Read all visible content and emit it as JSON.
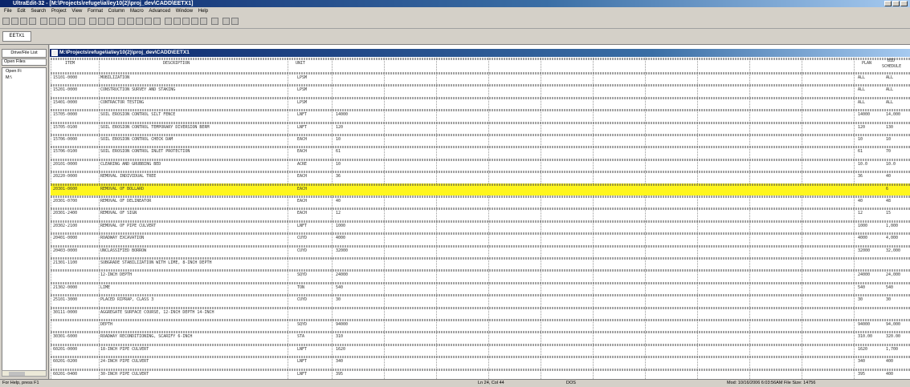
{
  "title": "UltraEdit-32 - [M:\\Projects\\refuge\\ia\\ley10(2)\\proj_dev\\CADD\\EETX1]",
  "menu": [
    "File",
    "Edit",
    "Search",
    "Project",
    "View",
    "Format",
    "Column",
    "Macro",
    "Advanced",
    "Window",
    "Help"
  ],
  "file_tab": "EETX1",
  "drive_tab": "Drive/File List",
  "open_files": "Open Files",
  "tree": [
    "Open Fi",
    "M:\\"
  ],
  "doc_title": "M:\\Projects\\refuge\\ia\\ley10(2)\\proj_dev\\CADD\\EETX1",
  "headers": {
    "item": "ITEM",
    "description": "DESCRIPTION",
    "unit": "UNIT",
    "plan": "PLAN",
    "bid": "BID",
    "schedule": "SCHEDULE"
  },
  "rows": [
    {
      "item": "15101-0000",
      "desc": "MOBILIZATION",
      "unit": "LPSM",
      "qty": "",
      "plan": "ALL",
      "bid": "ALL"
    },
    {
      "item": "15201-0000",
      "desc": "CONSTRUCTION SURVEY AND STAKING",
      "unit": "LPSM",
      "qty": "",
      "plan": "ALL",
      "bid": "ALL"
    },
    {
      "item": "15401-0000",
      "desc": "CONTRACTOR TESTING",
      "unit": "LPSM",
      "qty": "",
      "plan": "ALL",
      "bid": "ALL"
    },
    {
      "item": "15705-0000",
      "desc": "SOIL EROSION CONTROL  SILT FENCE",
      "unit": "LNFT",
      "qty": "14000",
      "plan": "14000",
      "bid": "14,000"
    },
    {
      "item": "15705-0100",
      "desc": "SOIL EROSION CONTROL  TEMPORARY DIVERSION BERM",
      "unit": "LNFT",
      "qty": "120",
      "plan": "120",
      "bid": "130"
    },
    {
      "item": "15706-0000",
      "desc": "SOIL EROSION CONTROL  CHECK DAM",
      "unit": "EACH",
      "qty": "10",
      "plan": "10",
      "bid": "10"
    },
    {
      "item": "15706-0100",
      "desc": "SOIL EROSION CONTROL  INLET PROTECTION",
      "unit": "EACH",
      "qty": "61",
      "plan": "61",
      "bid": "70"
    },
    {
      "item": "20101-0000",
      "desc": "CLEARING AND GRUBBING BED",
      "unit": "ACRE",
      "qty": "10",
      "plan": "10.0",
      "bid": "10.0"
    },
    {
      "item": "20220-0000",
      "desc": "REMOVAL  INDIVIDUAL TREE",
      "unit": "EACH",
      "qty": "36",
      "plan": "36",
      "bid": "40"
    },
    {
      "item": "20301-0600",
      "desc": "REMOVAL OF BOLLARD",
      "unit": "EACH",
      "qty": "",
      "plan": "",
      "bid": "6",
      "highlight": true
    },
    {
      "item": "20301-0700",
      "desc": "REMOVAL OF DELINEATOR",
      "unit": "EACH",
      "qty": "40",
      "plan": "40",
      "bid": "48"
    },
    {
      "item": "20301-2400",
      "desc": "REMOVAL OF SIGN",
      "unit": "EACH",
      "qty": "12",
      "plan": "12",
      "bid": "15"
    },
    {
      "item": "20302-2100",
      "desc": "REMOVAL OF PIPE CULVERT",
      "unit": "LNFT",
      "qty": "1000",
      "plan": "1000",
      "bid": "1,000"
    },
    {
      "item": "20401-0000",
      "desc": "ROADWAY EXCAVATION",
      "unit": "CUYD",
      "qty": "4000",
      "plan": "4000",
      "bid": "4,000"
    },
    {
      "item": "20403-0000",
      "desc": "UNCLASSIFIED BORROW",
      "unit": "CUYD",
      "qty": "32000",
      "plan": "32000",
      "bid": "32,000"
    },
    {
      "item": "21301-1100",
      "desc": "SUBGRADE STABILIZATION WITH LIME, 8-INCH DEPTH",
      "unit": "",
      "qty": "",
      "plan": "",
      "bid": ""
    },
    {
      "item": "",
      "desc": "12-INCH DEPTH",
      "unit": "SQYD",
      "qty": "24000",
      "plan": "24000",
      "bid": "24,000"
    },
    {
      "item": "21302-0000",
      "desc": "LIME",
      "unit": "TON",
      "qty": "540",
      "plan": "540",
      "bid": "540"
    },
    {
      "item": "25101-3000",
      "desc": "PLACED RIPRAP, CLASS 3",
      "unit": "CUYD",
      "qty": "30",
      "plan": "30",
      "bid": "30"
    },
    {
      "item": "30111-0000",
      "desc": "AGGREGATE SURFACE COURSE, 12-INCH DEPTH 14-INCH",
      "unit": "",
      "qty": "",
      "plan": "",
      "bid": ""
    },
    {
      "item": "",
      "desc": "DEPTH",
      "unit": "SQYD",
      "qty": "94000",
      "plan": "94000",
      "bid": "94,000"
    },
    {
      "item": "30301-6000",
      "desc": "ROADWAY RECONDITIONING, SCARIFY 6-INCH",
      "unit": "STA",
      "qty": "310",
      "plan": "310.00",
      "bid": "320.00"
    },
    {
      "item": "60201-0000",
      "desc": "18-INCH PIPE CULVERT",
      "unit": "LNFT",
      "qty": "1620",
      "plan": "1620",
      "bid": "1,700"
    },
    {
      "item": "60201-0200",
      "desc": "24-INCH PIPE CULVERT",
      "unit": "LNFT",
      "qty": "340",
      "plan": "340",
      "bid": "400"
    },
    {
      "item": "60201-0400",
      "desc": "30-INCH PIPE CULVERT",
      "unit": "LNFT",
      "qty": "395",
      "plan": "395",
      "bid": "400"
    }
  ],
  "status": {
    "help": "For Help, press F1",
    "pos": "Ln 24, Col 44",
    "mode": "DOS",
    "mod": "Mod: 10/16/2006 6:03:56AM  File Size: 14756"
  }
}
